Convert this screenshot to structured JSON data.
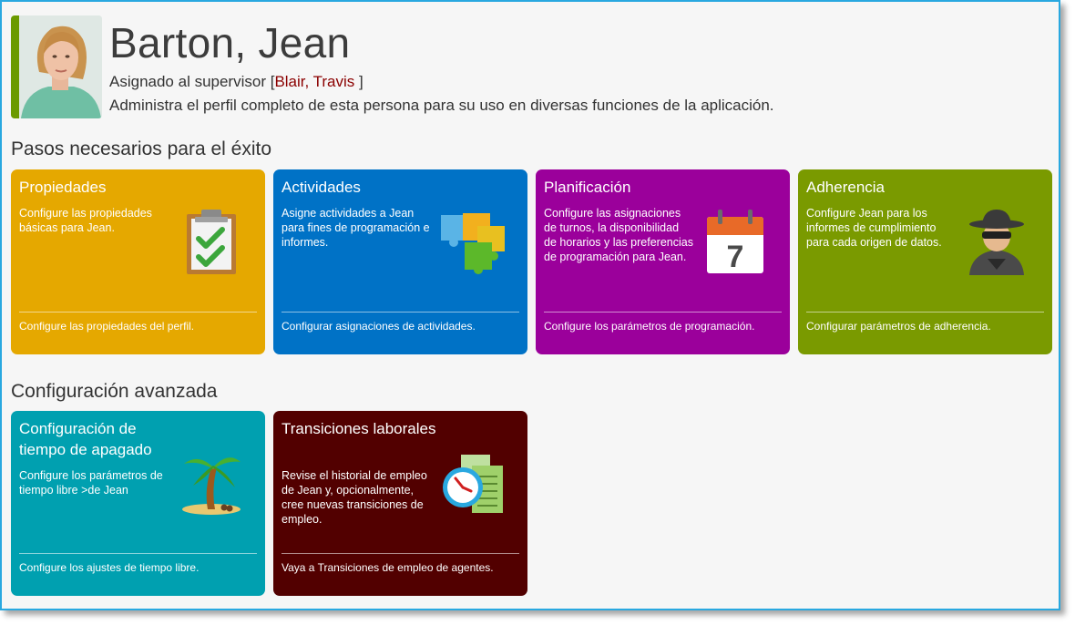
{
  "profile": {
    "name": "Barton, Jean",
    "supervisor_prefix": "Asignado al supervisor [",
    "supervisor_name": "Blair, Travis",
    "supervisor_suffix": " ]",
    "description": "Administra el perfil completo de esta persona para su uso en diversas funciones de la aplicación."
  },
  "sections": {
    "required": "Pasos necesarios para el éxito",
    "advanced": "Configuración avanzada"
  },
  "cards": {
    "properties": {
      "title": "Propiedades",
      "text": "Configure las propiedades básicas para Jean.",
      "footer": "Configure las propiedades del perfil.",
      "color": "#e5a800",
      "icon": "clipboard-check-icon"
    },
    "activities": {
      "title": "Actividades",
      "text": "Asigne actividades a Jean para fines de programación e informes.",
      "footer": "Configurar asignaciones de actividades.",
      "color": "#0072c6",
      "icon": "puzzle-icon"
    },
    "planning": {
      "title": "Planificación",
      "text": "Configure las asignaciones de turnos, la disponibilidad de horarios y las preferencias de programación para Jean.",
      "footer": "Configure los parámetros de programación.",
      "color": "#9b009b",
      "icon": "calendar-icon",
      "calendar_day": "7"
    },
    "adherence": {
      "title": "Adherencia",
      "text": "Configure Jean para los informes de cumplimiento para cada origen de datos.",
      "footer": "Configurar parámetros de adherencia.",
      "color": "#7a9a00",
      "icon": "spy-icon"
    },
    "timeoff": {
      "title": "Configuración de tiempo de apagado",
      "text": "Configure los parámetros de tiempo libre >de Jean",
      "footer": "Configure los ajustes de tiempo libre.",
      "color": "#00a0b0",
      "icon": "palm-tree-icon"
    },
    "transitions": {
      "title": "Transiciones laborales",
      "text": "Revise el historial de empleo de Jean y, opcionalmente, cree nuevas transiciones de empleo.",
      "footer": "Vaya a Transiciones de empleo de agentes.",
      "color": "#520000",
      "icon": "clock-documents-icon"
    }
  }
}
